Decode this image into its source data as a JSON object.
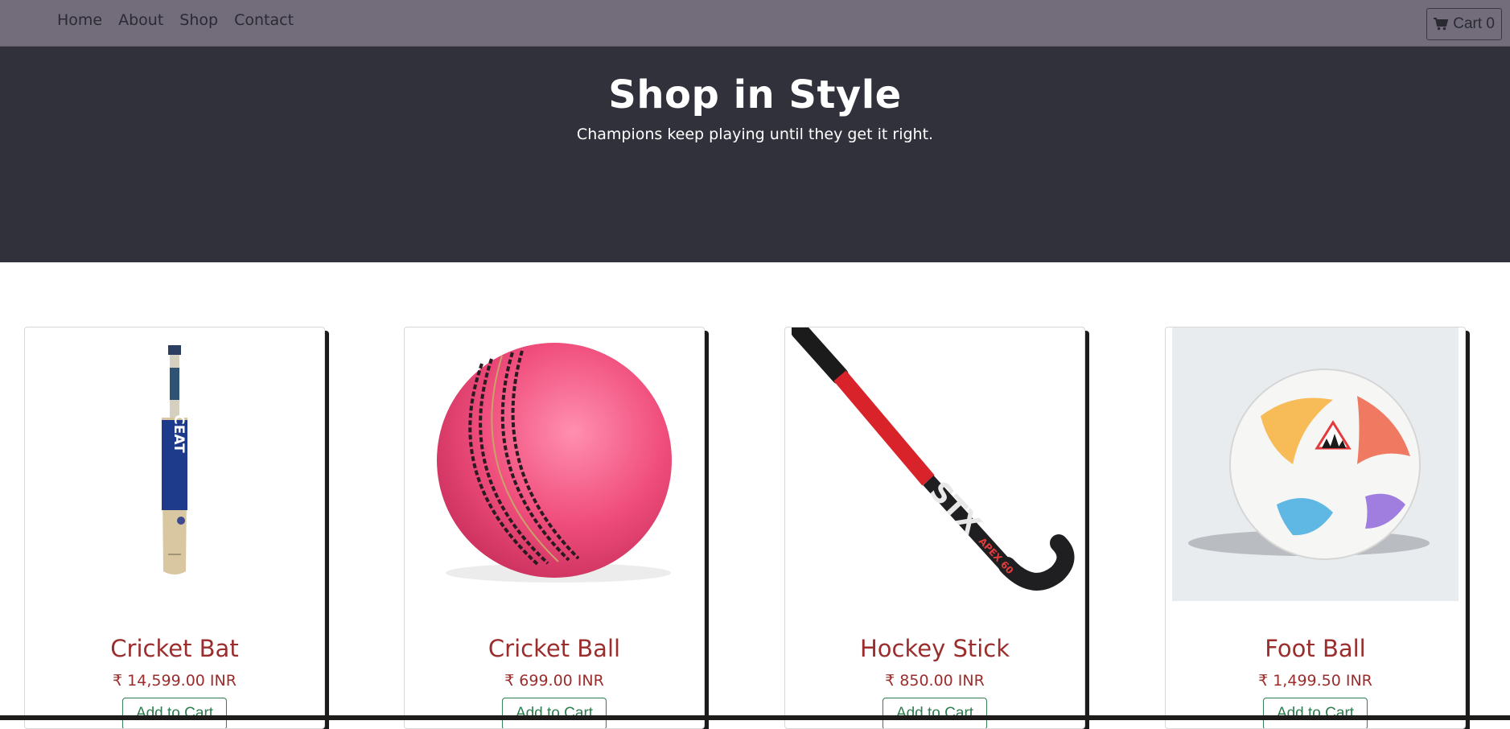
{
  "nav": {
    "links": [
      "Home",
      "About",
      "Shop",
      "Contact"
    ],
    "cart_label": "Cart 0"
  },
  "hero": {
    "title": "Shop in Style",
    "subtitle": "Champions keep playing until they get it right."
  },
  "products": [
    {
      "name": "Cricket Bat",
      "price": "₹ 14,599.00 INR",
      "button": "Add to Cart",
      "image_icon": "cricket-bat-icon",
      "brand_text": "CEAT"
    },
    {
      "name": "Cricket Ball",
      "price": "₹ 699.00 INR",
      "button": "Add to Cart",
      "image_icon": "cricket-ball-icon"
    },
    {
      "name": "Hockey Stick",
      "price": "₹ 850.00 INR",
      "button": "Add to Cart",
      "image_icon": "hockey-stick-icon",
      "brand_text": "STX",
      "model_text": "APEX 60"
    },
    {
      "name": "Foot Ball",
      "price": "₹ 1,499.50 INR",
      "button": "Add to Cart",
      "image_icon": "football-icon"
    }
  ],
  "colors": {
    "navbar": "#736d7b",
    "hero": "#31313c",
    "product_title": "#9b2d2d",
    "button_accent": "#2e7d4f"
  }
}
